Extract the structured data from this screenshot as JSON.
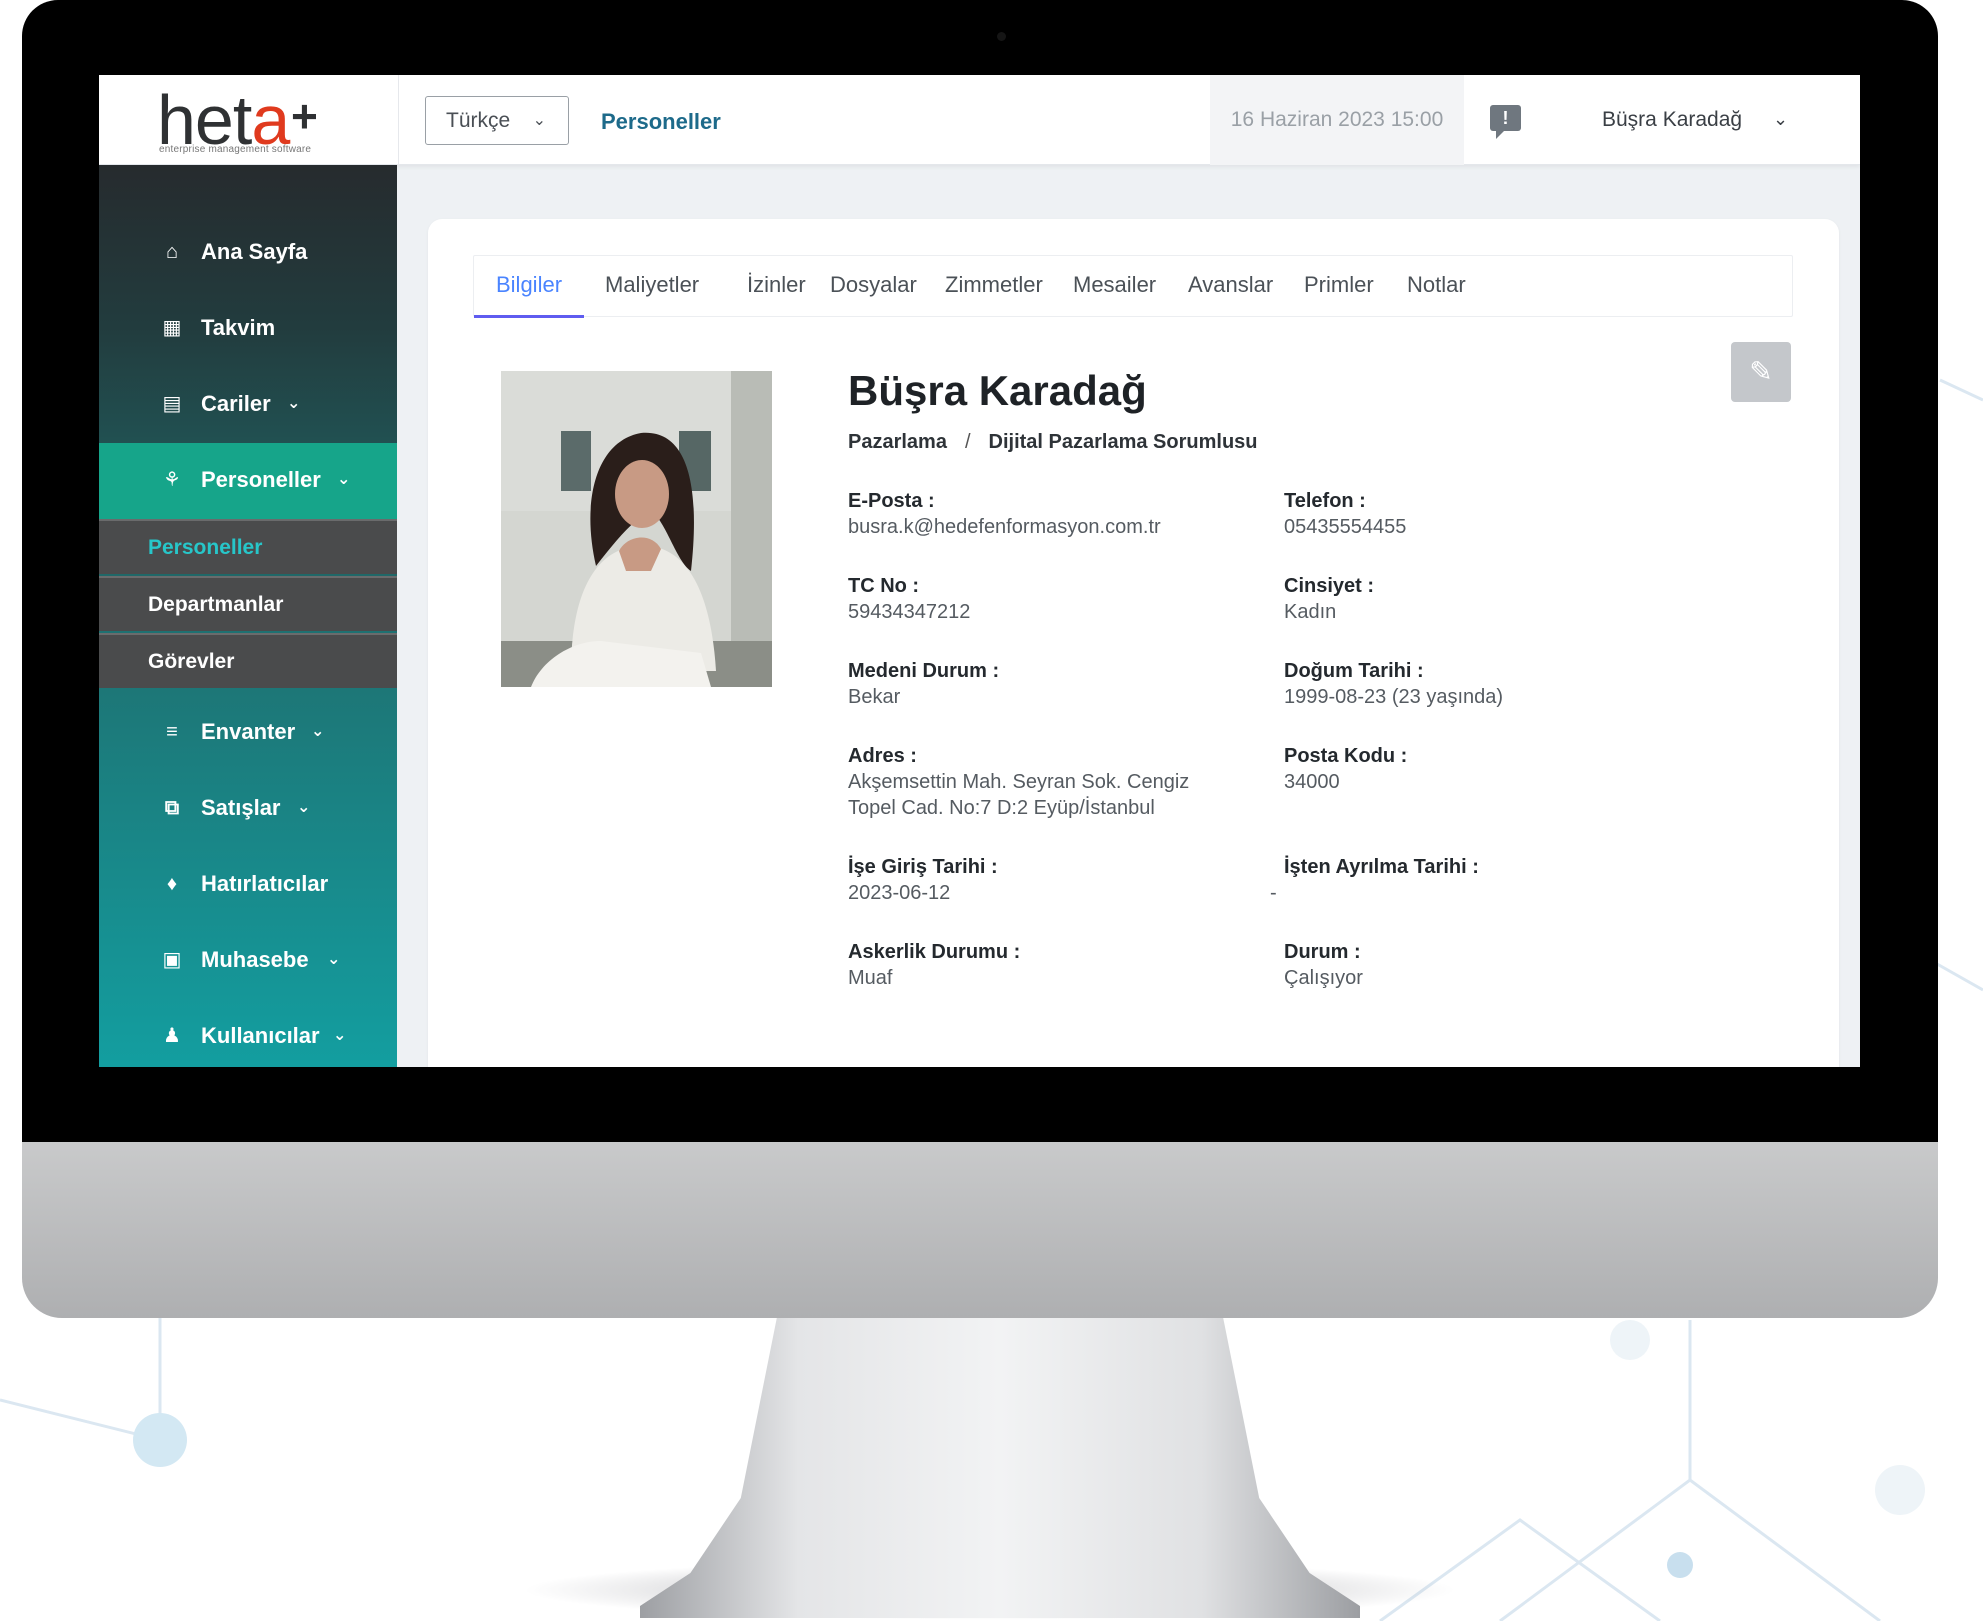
{
  "logo": {
    "main_a": "het",
    "main_b": "a",
    "plus": "+",
    "subtitle": "enterprise management software"
  },
  "topbar": {
    "language": "Türkçe",
    "breadcrumb": "Personeller",
    "datetime": "16 Haziran 2023 15:00",
    "user_name": "Büşra Karadağ"
  },
  "sidebar": {
    "items": [
      {
        "label": "Ana Sayfa",
        "icon": "home-icon"
      },
      {
        "label": "Takvim",
        "icon": "calendar-icon"
      },
      {
        "label": "Cariler",
        "icon": "id-card-icon"
      },
      {
        "label": "Personeller",
        "icon": "org-chart-icon"
      },
      {
        "label": "Envanter",
        "icon": "list-icon"
      },
      {
        "label": "Satışlar",
        "icon": "cart-icon"
      },
      {
        "label": "Hatırlatıcılar",
        "icon": "bell-icon"
      },
      {
        "label": "Muhasebe",
        "icon": "briefcase-icon"
      },
      {
        "label": "Kullanıcılar",
        "icon": "users-icon"
      }
    ],
    "sub_items": [
      "Personeller",
      "Departmanlar",
      "Görevler"
    ]
  },
  "tabs": [
    "Bilgiler",
    "Maliyetler",
    "İzinler",
    "Dosyalar",
    "Zimmetler",
    "Mesailer",
    "Avanslar",
    "Primler",
    "Notlar"
  ],
  "profile": {
    "name": "Büşra Karadağ",
    "department": "Pazarlama",
    "separator": "/",
    "position": "Dijital Pazarlama Sorumlusu",
    "fields": {
      "email": {
        "label": "E-Posta :",
        "value": "busra.k@hedefenformasyon.com.tr"
      },
      "phone": {
        "label": "Telefon :",
        "value": "05435554455"
      },
      "tc": {
        "label": "TC No :",
        "value": "59434347212"
      },
      "gender": {
        "label": "Cinsiyet :",
        "value": "Kadın"
      },
      "marital": {
        "label": "Medeni Durum :",
        "value": "Bekar"
      },
      "birth": {
        "label": "Doğum Tarihi :",
        "value": "1999-08-23 (23 yaşında)"
      },
      "address": {
        "label": "Adres :",
        "value_line1": "Akşemsettin Mah. Seyran Sok. Cengiz",
        "value_line2": "Topel Cad. No:7 D:2 Eyüp/İstanbul"
      },
      "postal": {
        "label": "Posta Kodu :",
        "value": "34000"
      },
      "start": {
        "label": "İşe Giriş Tarihi :",
        "value": "2023-06-12"
      },
      "end": {
        "label": "İşten Ayrılma Tarihi :",
        "value": "-"
      },
      "military": {
        "label": "Askerlik Durumu :",
        "value": "Muaf"
      },
      "status": {
        "label": "Durum :",
        "value": "Çalışıyor"
      }
    }
  },
  "colors": {
    "accent_tab": "#4a84ff",
    "sidebar_active": "#16a58a",
    "breadcrumb": "#1d6a8a"
  }
}
